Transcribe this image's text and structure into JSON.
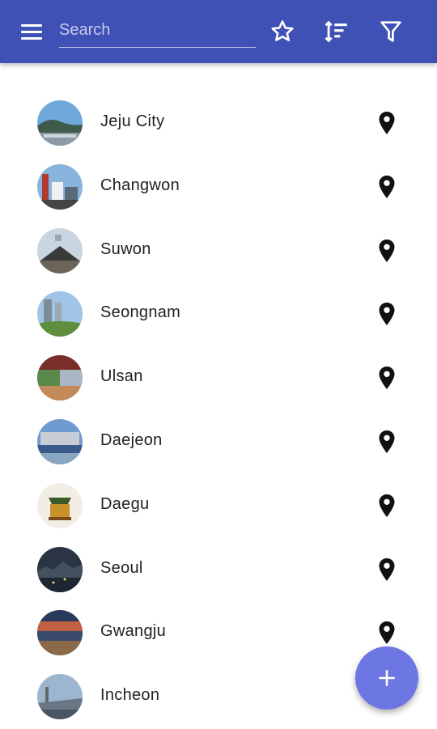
{
  "appbar": {
    "search_placeholder": "Search",
    "menu_icon": "menu-icon",
    "star_icon": "star-icon",
    "sort_icon": "sort-icon",
    "filter_icon": "filter-icon",
    "background_color": "#3f51b5"
  },
  "cities": [
    {
      "name": "Jeju City",
      "thumb": "jeju"
    },
    {
      "name": "Changwon",
      "thumb": "changwon"
    },
    {
      "name": "Suwon",
      "thumb": "suwon"
    },
    {
      "name": "Seongnam",
      "thumb": "seongnam"
    },
    {
      "name": "Ulsan",
      "thumb": "ulsan"
    },
    {
      "name": "Daejeon",
      "thumb": "daejeon"
    },
    {
      "name": "Daegu",
      "thumb": "daegu"
    },
    {
      "name": "Seoul",
      "thumb": "seoul"
    },
    {
      "name": "Gwangju",
      "thumb": "gwangju"
    },
    {
      "name": "Incheon",
      "thumb": "incheon"
    }
  ],
  "row_icon": "map-pin-icon",
  "fab": {
    "icon": "plus-icon",
    "color": "#6c77e4"
  }
}
